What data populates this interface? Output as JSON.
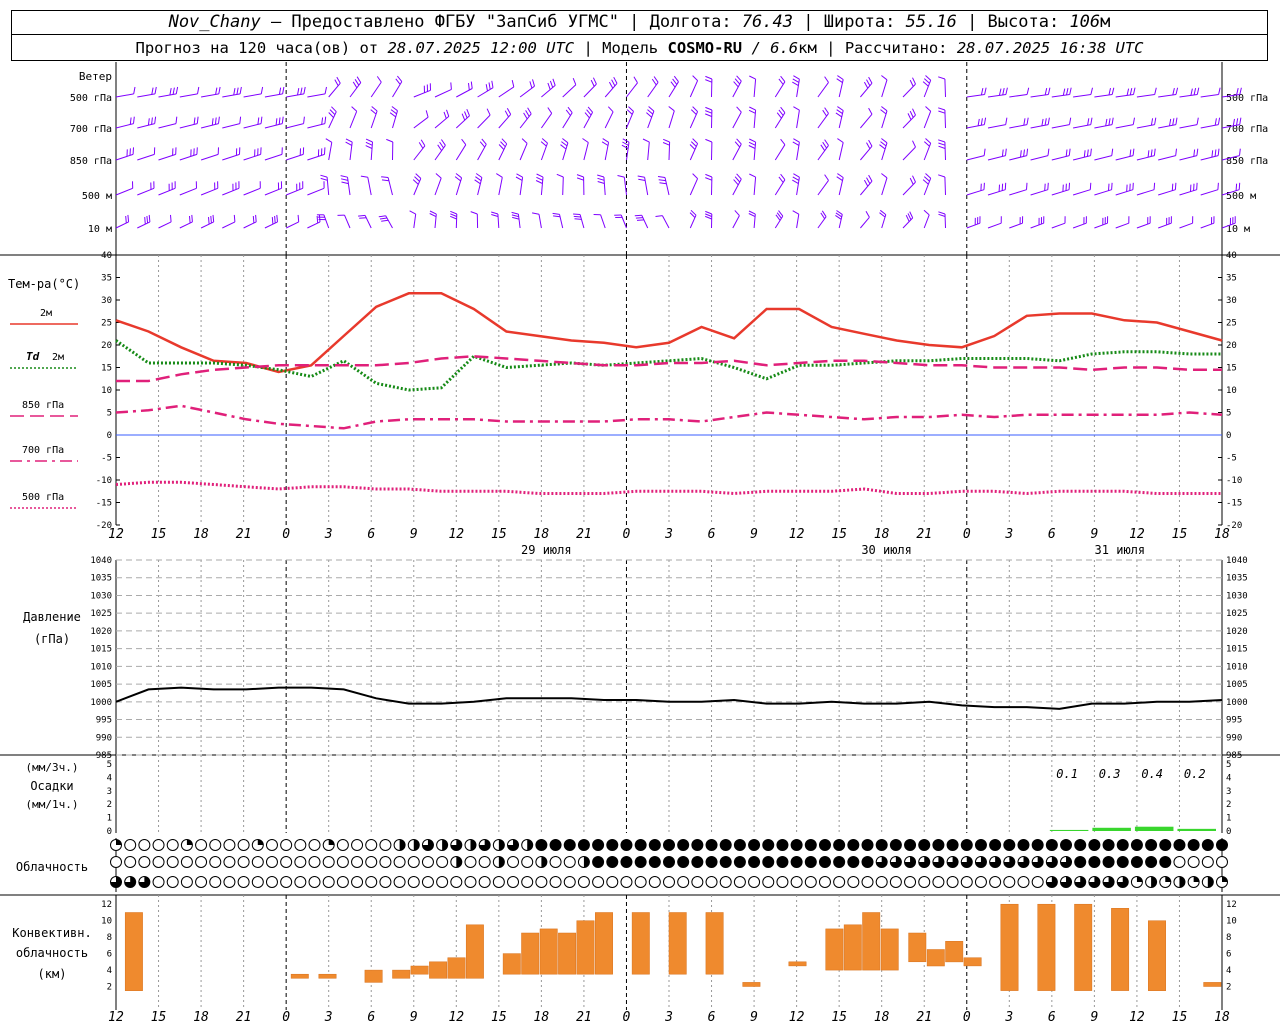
{
  "header": {
    "station": "Nov_Chany",
    "provider": "– Предоставлено ФГБУ \"ЗапСиб УГМС\" |",
    "lon_label": "Долгота:",
    "lon": "76.43",
    "lat_label": "| Широта:",
    "lat": "55.16",
    "alt_label": "| Высота:",
    "alt": "106",
    "alt_unit": "м",
    "forecast_label": "Прогноз на 120 часа(ов) от",
    "forecast_time": "28.07.2025 12:00 UTC",
    "model_label": "| Модель",
    "model": "COSMO-RU",
    "model_res": "/ 6.6",
    "model_res_unit": "км",
    "calc_label": "| Рассчитано:",
    "calc_time": "28.07.2025 16:38 UTC"
  },
  "wind_panel": {
    "title": "Ветер",
    "levels": [
      "500 гПа",
      "700 гПа",
      "850 гПа",
      "500 м",
      "10  м"
    ],
    "barb_color": "#7f00ff"
  },
  "temp_panel": {
    "title": "Тем-ра(°С)",
    "legend": [
      {
        "label": "2м",
        "color": "#e8392c",
        "style": "solid"
      },
      {
        "label": "Td",
        "label2": "2м",
        "color": "#168a16",
        "style": "dotted"
      },
      {
        "label": "850 гПа",
        "color": "#e0207a",
        "style": "dashed"
      },
      {
        "label": "700 гПа",
        "color": "#e0207a",
        "style": "dashdot"
      },
      {
        "label": "500 гПа",
        "color": "#e0207a",
        "style": "dotted"
      }
    ]
  },
  "pressure_panel": {
    "title": "Давление",
    "unit": "(гПа)"
  },
  "precip_panel": {
    "title": "Осадки",
    "unit3": "(мм/3ч.)",
    "unit1": "(мм/1ч.)",
    "labels": [
      "0.1",
      "0.3",
      "0.4",
      "0.2"
    ]
  },
  "cloud_panel": {
    "title": "Облачность"
  },
  "conv_panel": {
    "title1": "Конвективн.",
    "title2": "облачность",
    "unit": "(км)"
  },
  "time_axis": {
    "ticks": [
      "12",
      "15",
      "18",
      "21",
      "0",
      "3",
      "6",
      "9",
      "12",
      "15",
      "18",
      "21",
      "0",
      "3",
      "6",
      "9",
      "12",
      "15",
      "18",
      "21",
      "0",
      "3",
      "6",
      "9",
      "12",
      "15",
      "18"
    ],
    "dates": [
      "29 июля",
      "30 июля",
      "31 июля"
    ]
  },
  "chart_data": [
    {
      "type": "line",
      "title": "Тем-ра(°С)",
      "ylim": [
        -20,
        40
      ],
      "yticks": [
        -20,
        -15,
        -10,
        -5,
        0,
        5,
        10,
        15,
        20,
        25,
        30,
        35,
        40
      ],
      "x_hours": [
        0,
        3,
        6,
        9,
        12,
        15,
        18,
        21,
        24,
        27,
        30,
        33,
        36,
        39,
        42,
        45,
        48,
        51,
        54,
        57,
        60,
        63,
        66,
        69,
        72,
        75,
        78
      ],
      "series": [
        {
          "name": "2м",
          "color": "#e8392c",
          "values": [
            25.5,
            23,
            19.5,
            16.5,
            16,
            14,
            15.5,
            22,
            28.5,
            31.5,
            31.5,
            28,
            23,
            22,
            21,
            20.5,
            19.5,
            20.5,
            24,
            21.5,
            28,
            28,
            24,
            22.5,
            21,
            20,
            19.5,
            22,
            26.5,
            27,
            27,
            25.5,
            25,
            23,
            21
          ]
        },
        {
          "name": "Td 2м",
          "color": "#168a16",
          "values": [
            21,
            16,
            16,
            16,
            15.5,
            14.5,
            13,
            16.5,
            11.5,
            10,
            10.5,
            17.5,
            15,
            15.5,
            16,
            15.5,
            16,
            16.5,
            17,
            15,
            12.5,
            15.5,
            15.5,
            16,
            16.5,
            16.5,
            17,
            17,
            17,
            16.5,
            18,
            18.5,
            18.5,
            18,
            18
          ]
        },
        {
          "name": "850 гПа",
          "color": "#e0207a",
          "values": [
            12,
            12,
            13.5,
            14.5,
            15,
            15.5,
            15.5,
            15.5,
            15.5,
            16,
            17,
            17.5,
            17,
            16.5,
            16,
            15.5,
            15.5,
            16,
            16,
            16.5,
            15.5,
            16,
            16.5,
            16.5,
            16,
            15.5,
            15.5,
            15,
            15,
            15,
            14.5,
            15,
            15,
            14.5,
            14.5
          ]
        },
        {
          "name": "700 гПа",
          "color": "#e0207a",
          "values": [
            5,
            5.5,
            6.5,
            5,
            3.5,
            2.5,
            2,
            1.5,
            3,
            3.5,
            3.5,
            3.5,
            3,
            3,
            3,
            3,
            3.5,
            3.5,
            3,
            4,
            5,
            4.5,
            4,
            3.5,
            4,
            4,
            4.5,
            4,
            4.5,
            4.5,
            4.5,
            4.5,
            4.5,
            5,
            4.5
          ]
        },
        {
          "name": "500 гПа",
          "color": "#e0207a",
          "values": [
            -11,
            -10.5,
            -10.5,
            -11,
            -11.5,
            -12,
            -11.5,
            -11.5,
            -12,
            -12,
            -12.5,
            -12.5,
            -12.5,
            -13,
            -13,
            -13,
            -12.5,
            -12.5,
            -12.5,
            -13,
            -12.5,
            -12.5,
            -12.5,
            -12,
            -13,
            -13,
            -12.5,
            -12.5,
            -13,
            -12.5,
            -12.5,
            -12.5,
            -13,
            -13,
            -13
          ]
        }
      ]
    },
    {
      "type": "line",
      "title": "Давление",
      "ylim": [
        985,
        1040
      ],
      "yticks": [
        985,
        990,
        995,
        1000,
        1005,
        1010,
        1015,
        1020,
        1025,
        1030,
        1035,
        1040
      ],
      "series": [
        {
          "name": "Давление",
          "color": "#000000",
          "values": [
            1000,
            1003.5,
            1004,
            1003.5,
            1003.5,
            1004,
            1004,
            1003.5,
            1001,
            999.5,
            999.5,
            1000,
            1001,
            1001,
            1001,
            1000.5,
            1000.5,
            1000,
            1000,
            1000.5,
            999.5,
            999.5,
            1000,
            999.5,
            999.5,
            1000,
            999,
            998.5,
            998.5,
            998,
            999.5,
            999.5,
            1000,
            1000,
            1000.5
          ]
        }
      ]
    },
    {
      "type": "bar",
      "title": "Осадки",
      "ylim": [
        0,
        5
      ],
      "yticks": [
        0,
        1,
        2,
        3,
        4,
        5
      ],
      "bars": [
        {
          "h": 66,
          "v": 0.1
        },
        {
          "h": 69,
          "v": 0.3
        },
        {
          "h": 72,
          "v": 0.4
        },
        {
          "h": 75,
          "v": 0.2
        }
      ]
    },
    {
      "type": "bar",
      "title": "Конвективн. облачность",
      "ylim": [
        0,
        13
      ],
      "yticks": [
        2,
        4,
        6,
        8,
        10,
        12
      ],
      "bars": [
        [
          1,
          1.5,
          11
        ],
        [
          19,
          3,
          3.5
        ],
        [
          22,
          3,
          3.5
        ],
        [
          27,
          2.5,
          4
        ],
        [
          30,
          3,
          4
        ],
        [
          32,
          3.5,
          4.5
        ],
        [
          34,
          3,
          5
        ],
        [
          36,
          3,
          5.5
        ],
        [
          38,
          3,
          9.5
        ],
        [
          42,
          3.5,
          6
        ],
        [
          44,
          3.5,
          8.5
        ],
        [
          46,
          3.5,
          9
        ],
        [
          48,
          3.5,
          8.5
        ],
        [
          50,
          3.5,
          10
        ],
        [
          52,
          3.5,
          11
        ],
        [
          56,
          3.5,
          11
        ],
        [
          60,
          3.5,
          11
        ],
        [
          64,
          3.5,
          11
        ],
        [
          66,
          3.5,
          3.5
        ],
        [
          68,
          2,
          2.5
        ],
        [
          73,
          4.5,
          5
        ],
        [
          77,
          4,
          9
        ],
        [
          79,
          4,
          9.5
        ],
        [
          81,
          4,
          11
        ],
        [
          83,
          4,
          9
        ],
        [
          86,
          5,
          8.5
        ],
        [
          88,
          4.5,
          6.5
        ],
        [
          90,
          5,
          7.5
        ],
        [
          92,
          4.5,
          5.5
        ],
        [
          96,
          1.5,
          12
        ],
        [
          100,
          1.5,
          12
        ],
        [
          104,
          1.5,
          12
        ],
        [
          108,
          1.5,
          11.5
        ],
        [
          112,
          1.5,
          10
        ],
        [
          118,
          2,
          2.5
        ]
      ]
    }
  ]
}
